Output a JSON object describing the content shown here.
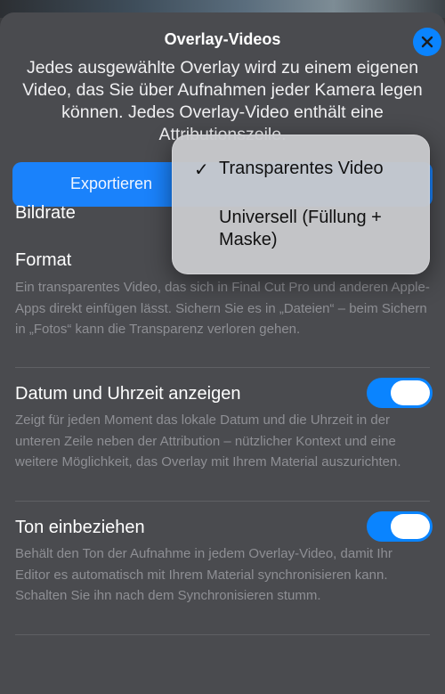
{
  "sheet": {
    "title": "Overlay-Videos",
    "description": "Jedes ausgewählte Overlay wird zu einem eigenen Video, das Sie über Aufnahmen jeder Kamera legen können. Jedes Overlay-Video enthält eine Attributionszeile."
  },
  "export_button": {
    "label": "Exportieren"
  },
  "settings": {
    "framerate": {
      "title": "Bildrate"
    },
    "format": {
      "title": "Format",
      "description": "Ein transparentes Video, das sich in Final Cut Pro und anderen Apple-Apps direkt einfügen lässt. Sichern Sie es in „Dateien“ – beim Sichern in „Fotos“ kann die Transparenz verloren gehen."
    },
    "datetime": {
      "title": "Datum und Uhrzeit anzeigen",
      "description": "Zeigt für jeden Moment das lokale Datum und die Uhrzeit in der unteren Zeile neben der Attribution – nützlicher Kontext und eine weitere Möglichkeit, das Overlay mit Ihrem Material auszurichten.",
      "enabled": true
    },
    "sound": {
      "title": "Ton einbeziehen",
      "description": "Behält den Ton der Aufnahme in jedem Overlay-Video, damit Ihr Editor es automatisch mit Ihrem Material synchronisieren kann. Schalten Sie ihn nach dem Synchronisieren stumm.",
      "enabled": true
    }
  },
  "format_menu": {
    "check_glyph": "✓",
    "options": [
      {
        "label": "Transparentes Video",
        "selected": true
      },
      {
        "label": "Universell (Füllung + Maske)",
        "selected": false
      }
    ]
  },
  "colors": {
    "accent": "#0a84ff",
    "sheet_background": "#4a4b4f",
    "secondary_text": "#8e8f94"
  },
  "icons": {
    "close": "xmark-icon",
    "check": "checkmark-icon"
  }
}
